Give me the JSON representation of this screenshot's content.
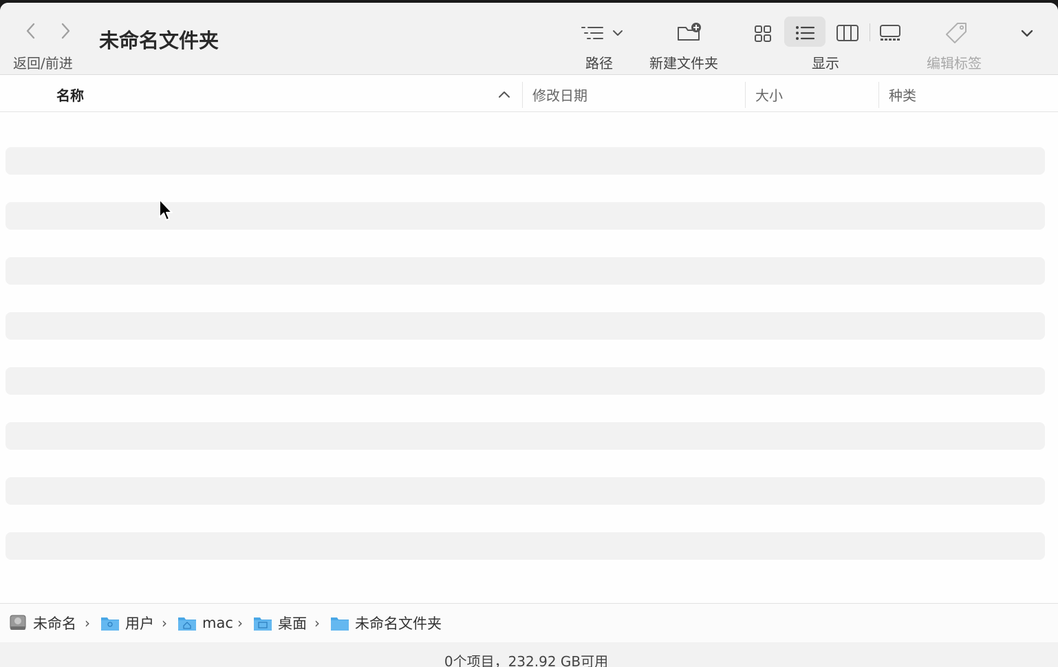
{
  "window": {
    "title": "未命名文件夹"
  },
  "toolbar": {
    "nav_label": "返回/前进",
    "path_label": "路径",
    "new_folder_label": "新建文件夹",
    "view_label": "显示",
    "tags_label": "编辑标签",
    "active_view": "list"
  },
  "columns": [
    {
      "label": "名称",
      "sorted": true,
      "sort_direction": "ascending"
    },
    {
      "label": "修改日期"
    },
    {
      "label": "大小"
    },
    {
      "label": "种类"
    }
  ],
  "pathbar": {
    "items": [
      {
        "label": "未命名",
        "icon": "disk-icon"
      },
      {
        "label": "用户",
        "icon": "users-folder-icon"
      },
      {
        "label": "mac",
        "icon": "home-folder-icon"
      },
      {
        "label": "桌面",
        "icon": "desktop-folder-icon"
      },
      {
        "label": "未命名文件夹",
        "icon": "folder-icon"
      }
    ]
  },
  "status": {
    "text": "0个项目，232.92 GB可用"
  },
  "colors": {
    "folder": "#4aa7e6",
    "window_bg": "#fefefe",
    "toolbar_bg": "#f2f2f2"
  }
}
